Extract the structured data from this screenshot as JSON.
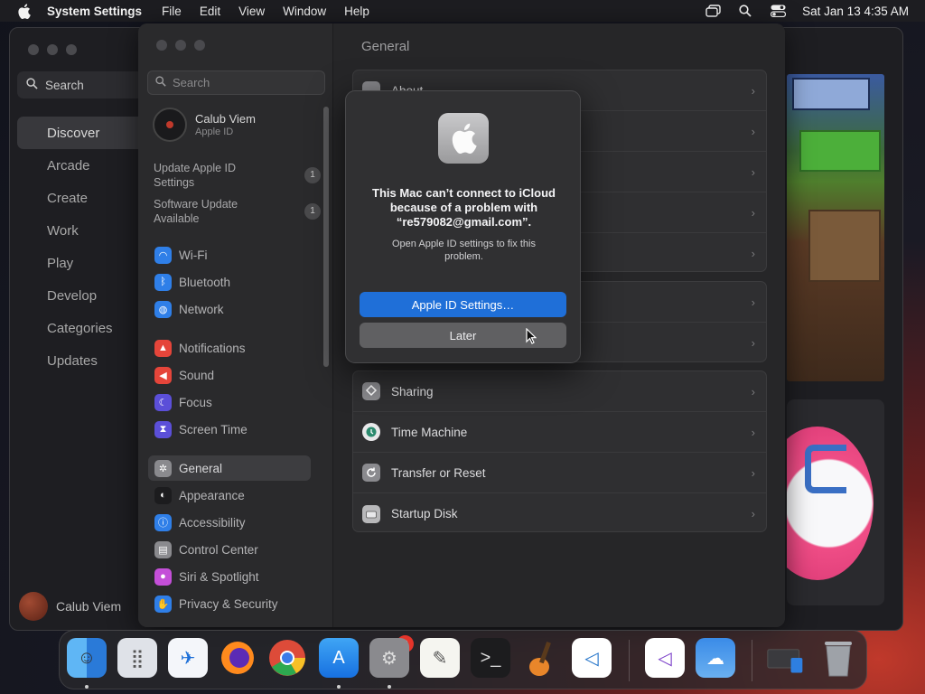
{
  "menubar": {
    "app_name": "System Settings",
    "menus": [
      "File",
      "Edit",
      "View",
      "Window",
      "Help"
    ],
    "clock": "Sat Jan 13  4:35 AM"
  },
  "appstore": {
    "search_placeholder": "Search",
    "nav": [
      "Discover",
      "Arcade",
      "Create",
      "Work",
      "Play",
      "Develop",
      "Categories",
      "Updates"
    ],
    "active_nav": "Discover",
    "user_name": "Calub Viem"
  },
  "settings": {
    "search_placeholder": "Search",
    "user": {
      "name": "Calub Viem",
      "subtitle": "Apple ID"
    },
    "alerts": [
      {
        "label": "Update Apple ID Settings",
        "count": "1"
      },
      {
        "label": "Software Update Available",
        "count": "1"
      }
    ],
    "sidebar_items": [
      {
        "label": "Wi-Fi",
        "icon": "wifi-icon",
        "color": "#2f7fe8"
      },
      {
        "label": "Bluetooth",
        "icon": "bluetooth-icon",
        "color": "#2f7fe8"
      },
      {
        "label": "Network",
        "icon": "globe-icon",
        "color": "#2f7fe8"
      },
      {
        "label": "Notifications",
        "icon": "bell-icon",
        "color": "#e5453a"
      },
      {
        "label": "Sound",
        "icon": "speaker-icon",
        "color": "#e5453a"
      },
      {
        "label": "Focus",
        "icon": "moon-icon",
        "color": "#5b4fd8"
      },
      {
        "label": "Screen Time",
        "icon": "hourglass-icon",
        "color": "#5b4fd8"
      },
      {
        "label": "General",
        "icon": "gear-icon",
        "color": "#8a8a8e"
      },
      {
        "label": "Appearance",
        "icon": "appearance-icon",
        "color": "#1c1c1e"
      },
      {
        "label": "Accessibility",
        "icon": "accessibility-icon",
        "color": "#2f7fe8"
      },
      {
        "label": "Control Center",
        "icon": "control-center-icon",
        "color": "#8a8a8e"
      },
      {
        "label": "Siri & Spotlight",
        "icon": "siri-icon",
        "color": "#c44fd8"
      },
      {
        "label": "Privacy & Security",
        "icon": "hand-icon",
        "color": "#2f7fe8"
      }
    ],
    "active_item": "General",
    "page_title": "General",
    "rows_top": [
      {
        "label": "About"
      }
    ],
    "rows_bottom": [
      {
        "label": "Sharing",
        "icon": "sharing-icon"
      },
      {
        "label": "Time Machine",
        "icon": "time-machine-icon"
      },
      {
        "label": "Transfer or Reset",
        "icon": "reset-icon"
      },
      {
        "label": "Startup Disk",
        "icon": "disk-icon"
      }
    ]
  },
  "dialog": {
    "title": "This Mac can’t connect to iCloud because of a problem with “re579082@gmail.com”.",
    "message": "Open Apple ID settings to fix this problem.",
    "primary_button": "Apple ID Settings…",
    "secondary_button": "Later"
  },
  "dock": {
    "apps": [
      "Finder",
      "Launchpad",
      "Safari",
      "Firefox",
      "Chrome",
      "App Store",
      "System Settings",
      "TextEdit",
      "Terminal",
      "GarageBand",
      "Visual Studio Code",
      "Visual Studio",
      "Weather",
      "Downloads",
      "Trash"
    ],
    "settings_badge": "2"
  }
}
